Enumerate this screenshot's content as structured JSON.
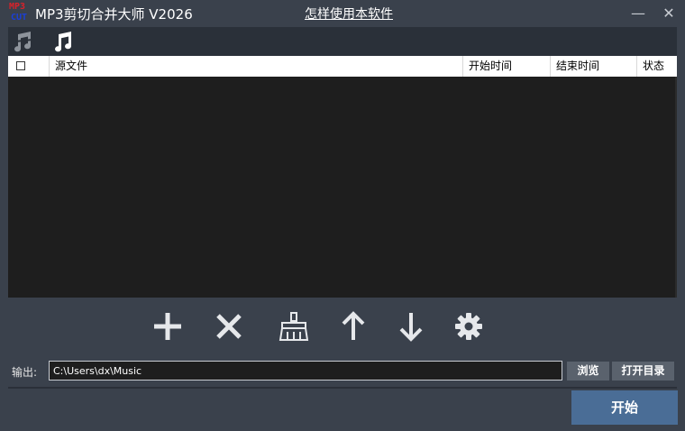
{
  "app": {
    "logo_line1": "MP3",
    "logo_line2": "CUT",
    "title": "MP3剪切合并大师 V2026",
    "help_link": "怎样使用本软件",
    "minimize_glyph": "—",
    "close_glyph": "✕"
  },
  "toolbar": {
    "items": [
      {
        "icon": "music-cut-icon",
        "state": "inactive"
      },
      {
        "icon": "music-merge-icon",
        "state": "active"
      }
    ]
  },
  "table": {
    "columns": [
      "源文件",
      "开始时间",
      "结束时间",
      "状态"
    ],
    "rows": []
  },
  "actions": [
    {
      "icon": "plus-icon"
    },
    {
      "icon": "close-icon"
    },
    {
      "icon": "broom-icon"
    },
    {
      "icon": "arrow-up-icon"
    },
    {
      "icon": "arrow-down-icon"
    },
    {
      "icon": "gear-icon"
    }
  ],
  "output": {
    "label": "输出:",
    "path": "C:\\Users\\dx\\Music",
    "browse_label": "浏览",
    "open_dir_label": "打开目录"
  },
  "start_label": "开始",
  "colors": {
    "background": "#3a414c",
    "panel": "#2a3039",
    "list": "#1e1e1e",
    "primary_button": "#4a6d96",
    "secondary_button": "#5a626d"
  }
}
